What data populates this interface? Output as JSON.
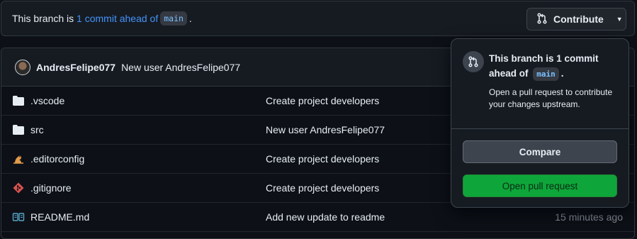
{
  "banner": {
    "prefix": "This branch is ",
    "ahead_link": "1 commit ahead of",
    "branch": "main",
    "suffix": "."
  },
  "contribute_button": {
    "label": "Contribute"
  },
  "latest_commit": {
    "author": "AndresFelipe077",
    "message": "New user AndresFelipe077"
  },
  "files": [
    {
      "icon": "folder-icon",
      "name": ".vscode",
      "message": "Create project developers",
      "time": ""
    },
    {
      "icon": "folder-icon",
      "name": "src",
      "message": "New user AndresFelipe077",
      "time": ""
    },
    {
      "icon": "editorconfig-icon",
      "name": ".editorconfig",
      "message": "Create project developers",
      "time": ""
    },
    {
      "icon": "git-icon",
      "name": ".gitignore",
      "message": "Create project developers",
      "time": ""
    },
    {
      "icon": "book-icon",
      "name": "README.md",
      "message": "Add new update to readme",
      "time": "15 minutes ago"
    }
  ],
  "popover": {
    "title_prefix": "This branch is 1 commit ahead of",
    "branch": "main",
    "title_suffix": ".",
    "description": "Open a pull request to contribute your changes upstream.",
    "compare_label": "Compare",
    "open_pr_label": "Open pull request"
  },
  "colors": {
    "background": "#0d1117",
    "accent_link": "#4493f8",
    "primary_button": "#0ea63a"
  }
}
